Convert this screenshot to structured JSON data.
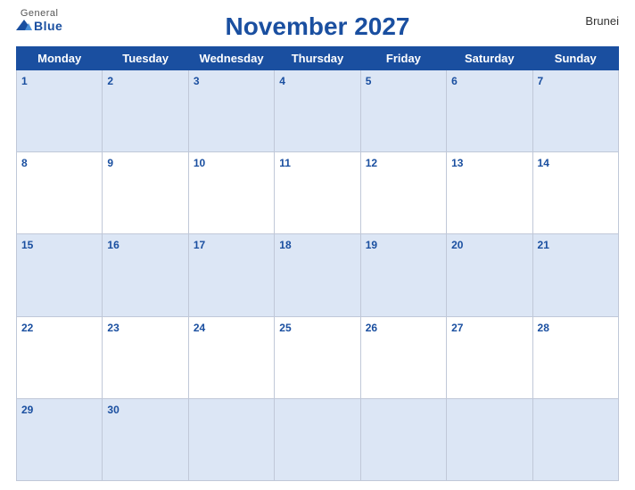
{
  "header": {
    "logo_general": "General",
    "logo_blue": "Blue",
    "title": "November 2027",
    "country": "Brunei"
  },
  "days_of_week": [
    "Monday",
    "Tuesday",
    "Wednesday",
    "Thursday",
    "Friday",
    "Saturday",
    "Sunday"
  ],
  "weeks": [
    [
      {
        "num": "1",
        "empty": false
      },
      {
        "num": "2",
        "empty": false
      },
      {
        "num": "3",
        "empty": false
      },
      {
        "num": "4",
        "empty": false
      },
      {
        "num": "5",
        "empty": false
      },
      {
        "num": "6",
        "empty": false
      },
      {
        "num": "7",
        "empty": false
      }
    ],
    [
      {
        "num": "8",
        "empty": false
      },
      {
        "num": "9",
        "empty": false
      },
      {
        "num": "10",
        "empty": false
      },
      {
        "num": "11",
        "empty": false
      },
      {
        "num": "12",
        "empty": false
      },
      {
        "num": "13",
        "empty": false
      },
      {
        "num": "14",
        "empty": false
      }
    ],
    [
      {
        "num": "15",
        "empty": false
      },
      {
        "num": "16",
        "empty": false
      },
      {
        "num": "17",
        "empty": false
      },
      {
        "num": "18",
        "empty": false
      },
      {
        "num": "19",
        "empty": false
      },
      {
        "num": "20",
        "empty": false
      },
      {
        "num": "21",
        "empty": false
      }
    ],
    [
      {
        "num": "22",
        "empty": false
      },
      {
        "num": "23",
        "empty": false
      },
      {
        "num": "24",
        "empty": false
      },
      {
        "num": "25",
        "empty": false
      },
      {
        "num": "26",
        "empty": false
      },
      {
        "num": "27",
        "empty": false
      },
      {
        "num": "28",
        "empty": false
      }
    ],
    [
      {
        "num": "29",
        "empty": false
      },
      {
        "num": "30",
        "empty": false
      },
      {
        "num": "",
        "empty": true
      },
      {
        "num": "",
        "empty": true
      },
      {
        "num": "",
        "empty": true
      },
      {
        "num": "",
        "empty": true
      },
      {
        "num": "",
        "empty": true
      }
    ]
  ],
  "colors": {
    "header_bg": "#1a4fa0",
    "row_odd_bg": "#dce6f5",
    "row_even_bg": "#ffffff",
    "day_num_color": "#1a4fa0",
    "border": "#c0c8d8"
  }
}
